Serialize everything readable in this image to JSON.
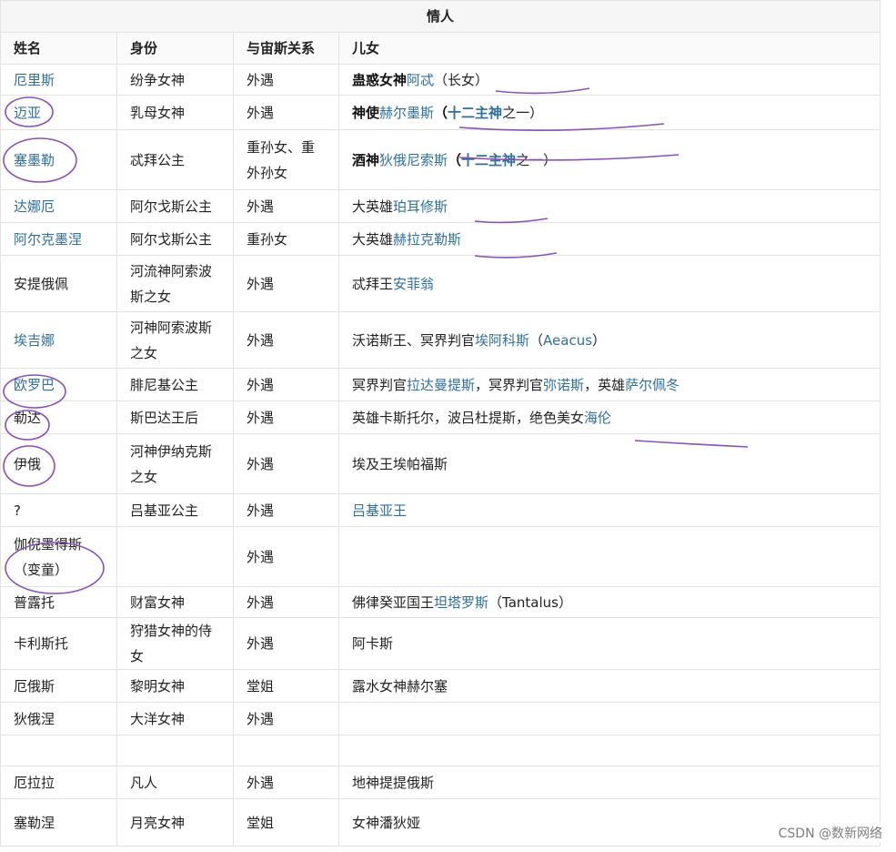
{
  "table": {
    "title": "情人",
    "headers": [
      "姓名",
      "身份",
      "与宙斯关系",
      "儿女"
    ],
    "rows": [
      {
        "name": "厄里斯",
        "name_link": true,
        "identity": "纷争女神",
        "relation": "外遇",
        "children": [
          {
            "t": "蛊惑女神",
            "b": true
          },
          {
            "t": "阿忒",
            "l": true
          },
          {
            "t": "（长女）"
          }
        ]
      },
      {
        "name": "迈亚",
        "name_link": true,
        "identity": "乳母女神",
        "relation": "外遇",
        "children": [
          {
            "t": "神使",
            "b": true
          },
          {
            "t": "赫尔墨斯",
            "l": true
          },
          {
            "t": "（",
            "b": true
          },
          {
            "t": "十二主神",
            "b": true,
            "l": true
          },
          {
            "t": "之一）"
          }
        ]
      },
      {
        "name": "塞墨勒",
        "name_link": true,
        "identity": "忒拜公主",
        "relation": "重孙女、重外孙女",
        "children": [
          {
            "t": "酒神",
            "b": true
          },
          {
            "t": "狄俄尼索斯",
            "l": true
          },
          {
            "t": "（",
            "b": true
          },
          {
            "t": "十二主神",
            "b": true,
            "l": true
          },
          {
            "t": "之一）"
          }
        ]
      },
      {
        "name": "达娜厄",
        "name_link": true,
        "identity": "阿尔戈斯公主",
        "relation": "外遇",
        "children": [
          {
            "t": "大英雄"
          },
          {
            "t": "珀耳修斯",
            "l": true
          }
        ]
      },
      {
        "name": "阿尔克墨涅",
        "name_link": true,
        "identity": "阿尔戈斯公主",
        "relation": "重孙女",
        "children": [
          {
            "t": "大英雄"
          },
          {
            "t": "赫拉克勒斯",
            "l": true
          }
        ]
      },
      {
        "name": "安提俄佩",
        "name_link": false,
        "identity": "河流神阿索波斯之女",
        "relation": "外遇",
        "children": [
          {
            "t": "忒拜王"
          },
          {
            "t": "安菲翁",
            "l": true
          }
        ]
      },
      {
        "name": "埃吉娜",
        "name_link": true,
        "identity": "河神阿索波斯之女",
        "relation": "外遇",
        "children": [
          {
            "t": "沃诺斯王、冥界判官"
          },
          {
            "t": "埃阿科斯",
            "l": true
          },
          {
            "t": "（"
          },
          {
            "t": "Aeacus",
            "l": true
          },
          {
            "t": "）"
          }
        ]
      },
      {
        "name": "欧罗巴",
        "name_link": true,
        "identity": "腓尼基公主",
        "relation": "外遇",
        "children": [
          {
            "t": "冥界判官"
          },
          {
            "t": "拉达曼提斯",
            "l": true
          },
          {
            "t": "，冥界判官"
          },
          {
            "t": "弥诺斯",
            "l": true
          },
          {
            "t": "，英雄"
          },
          {
            "t": "萨尔佩冬",
            "l": true
          }
        ]
      },
      {
        "name": "勒达",
        "name_link": false,
        "identity": "斯巴达王后",
        "relation": "外遇",
        "children": [
          {
            "t": "英雄卡斯托尔，波吕杜提斯，绝色美女"
          },
          {
            "t": "海伦",
            "l": true
          }
        ]
      },
      {
        "name": "伊俄",
        "name_link": false,
        "identity": "河神伊纳克斯之女",
        "relation": "外遇",
        "children": [
          {
            "t": "埃及王埃帕福斯"
          }
        ]
      },
      {
        "name": "?",
        "name_link": false,
        "identity": "吕基亚公主",
        "relation": "外遇",
        "children": [
          {
            "t": "吕基亚",
            "l": true
          },
          {
            "t": "王",
            "l": true
          }
        ]
      },
      {
        "name": "伽倪墨得斯（变童）",
        "name_link": false,
        "identity": "",
        "relation": "外遇",
        "children": []
      },
      {
        "name": "普露托",
        "name_link": false,
        "identity": "财富女神",
        "relation": "外遇",
        "children": [
          {
            "t": "佛律癸亚国王"
          },
          {
            "t": "坦塔罗斯",
            "l": true
          },
          {
            "t": "（Tantalus）"
          }
        ]
      },
      {
        "name": "卡利斯托",
        "name_link": false,
        "identity": "狩猎女神的侍女",
        "relation": "外遇",
        "children": [
          {
            "t": "阿卡斯"
          }
        ]
      },
      {
        "name": "厄俄斯",
        "name_link": false,
        "identity": "黎明女神",
        "relation": "堂姐",
        "children": [
          {
            "t": "露水女神赫尔塞"
          }
        ]
      },
      {
        "name": "狄俄涅",
        "name_link": false,
        "identity": "大洋女神",
        "relation": "外遇",
        "children": []
      },
      {
        "name": "厄拉拉",
        "name_link": false,
        "identity": "凡人",
        "relation": "外遇",
        "children": [
          {
            "t": "地神提提俄斯"
          }
        ]
      },
      {
        "name": "塞勒涅",
        "name_link": false,
        "identity": "月亮女神",
        "relation": "堂姐",
        "children": [
          {
            "t": "女神潘狄娅"
          }
        ]
      }
    ]
  },
  "watermark": "CSDN @数新网络",
  "colors": {
    "link": "#2e6f9e",
    "annotation_ink": "#8b4fb8",
    "border": "#e3e3e3"
  }
}
